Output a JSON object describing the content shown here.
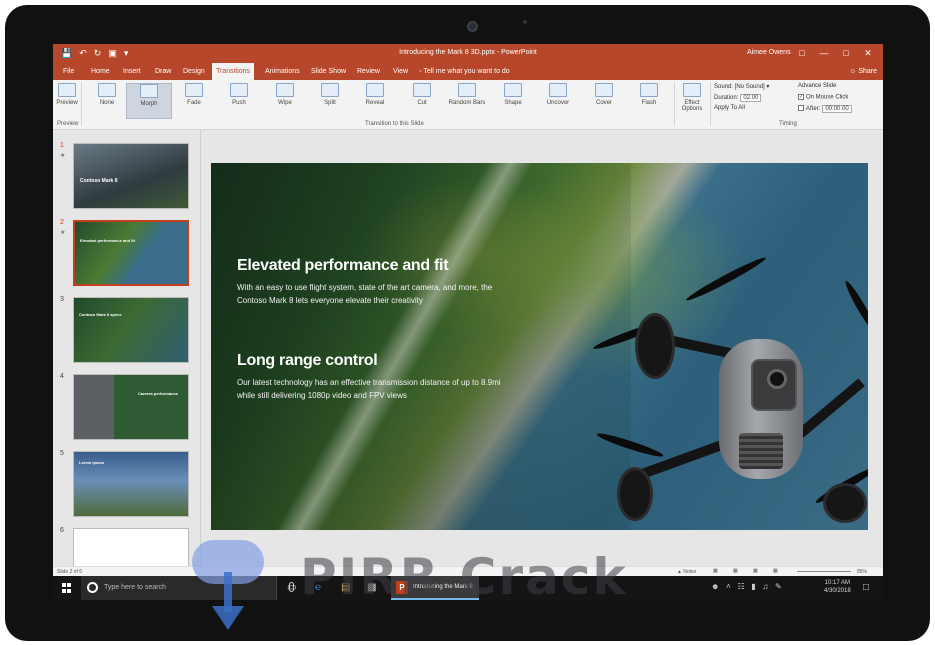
{
  "window": {
    "title": "Introducing the Mark 8 3D.pptx  -  PowerPoint",
    "user": "Aimee Owens",
    "controls": [
      "—",
      "□",
      "✕"
    ]
  },
  "tabs": [
    "File",
    "Home",
    "Insert",
    "Draw",
    "Design",
    "Transitions",
    "Animations",
    "Slide Show",
    "Review",
    "View"
  ],
  "tell_me": "Tell me what you want to do",
  "share": "Share",
  "ribbon": {
    "preview": "Preview",
    "transitions": [
      "None",
      "Morph",
      "Fade",
      "Push",
      "Wipe",
      "Split",
      "Reveal",
      "Cut",
      "Random Bars",
      "Shape",
      "Uncover",
      "Cover",
      "Flash"
    ],
    "effect_options": "Effect Options",
    "sound": "Sound: [No Sound]",
    "duration_label": "Duration:",
    "duration_value": "02.00",
    "apply_all": "Apply To All",
    "advance_slide": "Advance Slide",
    "on_mouse_click": "On Mouse Click",
    "after_label": "After:",
    "after_value": "00:00.00",
    "group_preview": "Preview",
    "group_transition": "Transition to this Slide",
    "group_timing": "Timing"
  },
  "thumbnails": [
    {
      "num": "1",
      "star": "★",
      "title": "Contoso Mark 8"
    },
    {
      "num": "2",
      "star": "★",
      "title": "Elevated performance and fit"
    },
    {
      "num": "3",
      "star": "",
      "title": "Contoso Mark 8 specs"
    },
    {
      "num": "4",
      "star": "",
      "title": "Camera performance"
    },
    {
      "num": "5",
      "star": "",
      "title": "Lorem ipsum"
    },
    {
      "num": "6",
      "star": "",
      "title": ""
    }
  ],
  "slide": {
    "heading1": "Elevated performance and fit",
    "body1": "With an easy to use flight system, state of the art camera, and more, the Contoso Mark 8 lets everyone elevate their creativity",
    "heading2": "Long range control",
    "body2": "Our latest technology has an effective transmission distance of up to 8.9mi while still delivering 1080p video and FPV views"
  },
  "status": {
    "slide_of": "Slide 2 of 6",
    "notes": "Notes",
    "zoom": "85%"
  },
  "taskbar": {
    "search_placeholder": "Type here to search",
    "ppt_task": "Introducing the Mark 8",
    "time": "10:17 AM",
    "date": "4/30/2018"
  },
  "watermark": {
    "text": "PIRR Crack"
  },
  "colors": {
    "accent": "#b7472a",
    "selection": "#c43e1c",
    "taskbar": "#141414"
  }
}
